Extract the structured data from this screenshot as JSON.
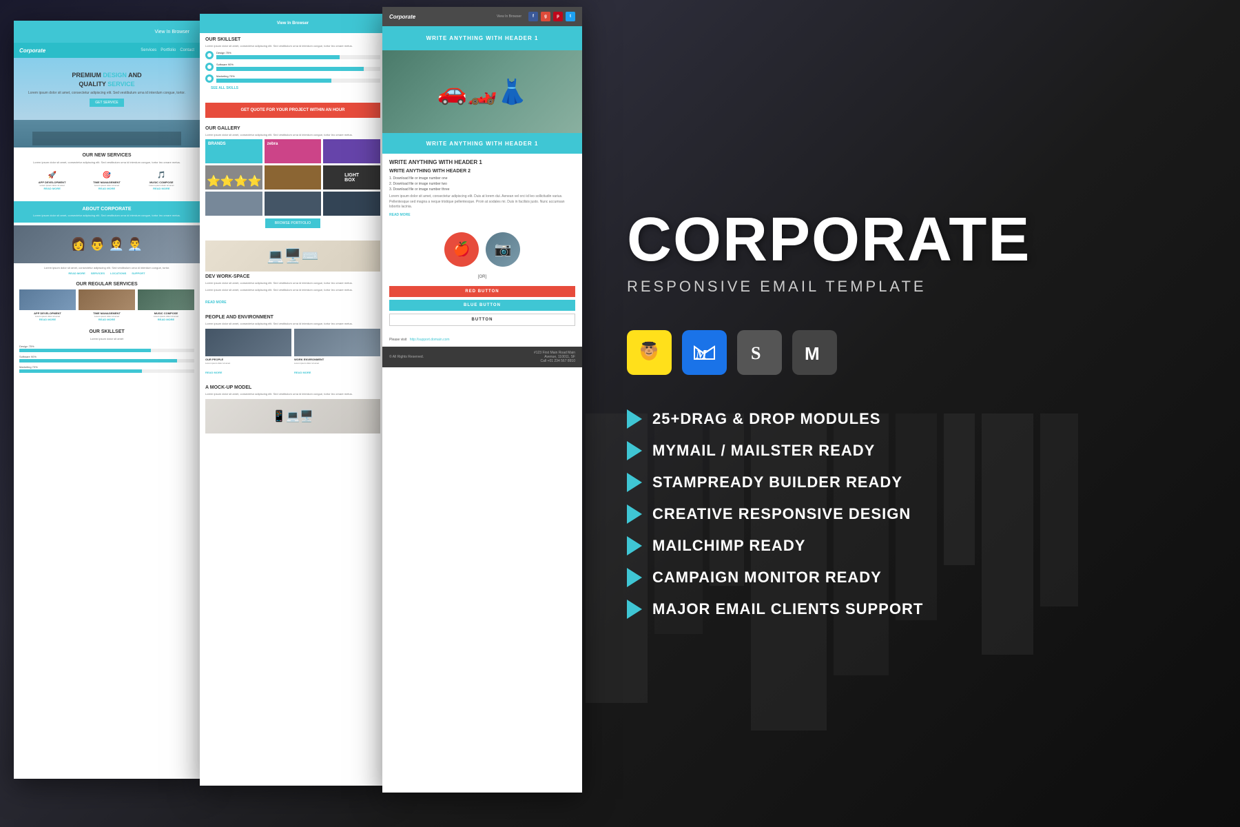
{
  "panels": {
    "panel1": {
      "header": "View In Browser",
      "nav": {
        "logo": "Corporate",
        "links": [
          "Services",
          "Portfolio",
          "Contact"
        ]
      },
      "hero": {
        "title_part1": "PREMIUM ",
        "title_highlight1": "DESIGN",
        "title_part2": " AND",
        "title_line2_part1": "QUALITY ",
        "title_highlight2": "SERVICE",
        "subtitle": "Lorem ipsum dolor sit amet, consectetur adipiscing elit. Sed vestibulum urna id interdum congue, tortor.",
        "button": "GET SERVICE"
      },
      "services_section": {
        "title": "OUR NEW SERVICES",
        "text": "Lorem ipsum dolor sit amet, consectetur adipiscing elit. Sed vestibulum urna id interdum congue, tortor leo ornare metus.",
        "items": [
          {
            "icon": "🚀",
            "name": "APP DEVELOPMENT",
            "readmore": "READ MORE"
          },
          {
            "icon": "🎯",
            "name": "TIME MANAGEMENT",
            "readmore": "READ MORE"
          },
          {
            "icon": "🎵",
            "name": "MUSIC COMPOSE",
            "readmore": "READ MORE"
          }
        ]
      },
      "about": {
        "title": "ABOUT CORPORATE",
        "text": "Lorem ipsum dolor sit amet, consectetur adipiscing elit. Sed vestibulum urna id interdum congue, tortor leo ornare metus."
      },
      "reg_services": {
        "title": "OUR REGULAR SERVICES",
        "items": [
          {
            "name": "APP DEVELOPMENT"
          },
          {
            "name": "TIME MANAGEMENT"
          },
          {
            "name": "MUSIC COMPOSE"
          }
        ]
      },
      "skillset": {
        "title": "OUR SKILLSET",
        "skills": [
          {
            "name": "Design 75%",
            "pct": 75
          },
          {
            "name": "Software 90%",
            "pct": 90
          },
          {
            "name": "Marketing 70%",
            "pct": 70
          }
        ]
      }
    },
    "panel2": {
      "skillset": {
        "title": "OUR SKILLSET",
        "text": "Lorem ipsum dolor sit amet, consectetur adipiscing elit. Sed vestibulum urna id interdum congue, tortor leo ornare metus.",
        "skills": [
          {
            "name": "Design 75%",
            "pct": 75
          },
          {
            "name": "Software 90%",
            "pct": 90
          },
          {
            "name": "Marketing 70%",
            "pct": 70
          }
        ],
        "see_all": "SEE ALL SKILLS"
      },
      "quote": {
        "title": "GET QUOTE FOR YOUR PROJECT WITHIN AN HOUR",
        "text": ""
      },
      "gallery": {
        "title": "OUR GALLERY",
        "text": "Lorem ipsum dolor sit amet, consectetur adipiscing elit. Sed vestibulum urna id interdum congue, tortor leo ornare metus.",
        "button": "BROWSE PORTFOLIO"
      },
      "dev_workspace": {
        "title": "DEV WORK-SPACE",
        "text": "Lorem ipsum dolor sit amet, consectetur adipiscing elit. Sed vestibulum urna id interdum congue, tortor leo ornare metus."
      },
      "people": {
        "title": "PEOPLE AND ENVIRONMENT",
        "text": "Lorem ipsum dolor sit amet, consectetur adipiscing elit. Sed vestibulum urna id interdum congue, tortor leo ornare metus.",
        "our_people": "OUR PEOPLE",
        "work_env": "WORK ENVIRONMENT"
      },
      "mockup": {
        "title": "A MOCK-UP MODEL",
        "text": "Lorem ipsum dolor sit amet, consectetur adipiscing elit. Sed vestibulum urna id interdum congue, tortor leo ornare metus."
      }
    },
    "panel3": {
      "header": {
        "logo": "Corporate",
        "view_browser": "View In Browser",
        "socials": [
          "f",
          "g+",
          "p",
          "t"
        ]
      },
      "hero_banner": "WRITE ANYTHING WITH HEADER 1",
      "header2_banner": "WRITE ANYTHING WITH HEADER 1",
      "h1": "WRITE ANYTHING WITH HEADER 1",
      "h2": "WRITE ANYTHING WITH HEADER 2",
      "list": [
        "1. Download file or image number one",
        "2. Download file or image number two",
        "3. Download file or image number three"
      ],
      "para": "Lorem ipsum dolor sit amet, consectetur adipiscing elit. Duis at lorem dui. Aenean vel orci id leo sollicitudin varius. Pellentesque sed magna a neque tristique pellentesque. Proin at sodales mi. Duis in facilisis justo. Nunc accumsan lobortis lacinia.",
      "read_more": "READ MORE",
      "or_label": "[OR]",
      "buttons": {
        "red": "RED BUTTON",
        "blue": "BLUE BUTTON",
        "outline": "BUTTON"
      },
      "link_text": "Please visit",
      "link_url": "http://support.domain.com",
      "footer": {
        "copy": "© All Rights Reserved.",
        "address": "#123 First Main Road Main\nAvenue, 110011, SF\nCall +01 234 567 8910"
      }
    }
  },
  "right": {
    "title": "CORPORATE",
    "subtitle": "RESPONSIVE EMAIL TEMPLATE",
    "email_clients": [
      {
        "name": "MailChimp",
        "color": "#ffe01b"
      },
      {
        "name": "Gmail",
        "color": "#1a73e8"
      },
      {
        "name": "StampReady",
        "color": "#555"
      },
      {
        "name": "Mailster",
        "color": "#444"
      }
    ],
    "features": [
      "25+DRAG & DROP MODULES",
      "MYMAIL / MAILSTER READY",
      "STAMPREADY BUILDER READY",
      "CREATIVE RESPONSIVE DESIGN",
      "MAILCHIMP READY",
      "CAMPAIGN MONITOR READY",
      "MAJOR EMAIL CLIENTS SUPPORT"
    ]
  }
}
